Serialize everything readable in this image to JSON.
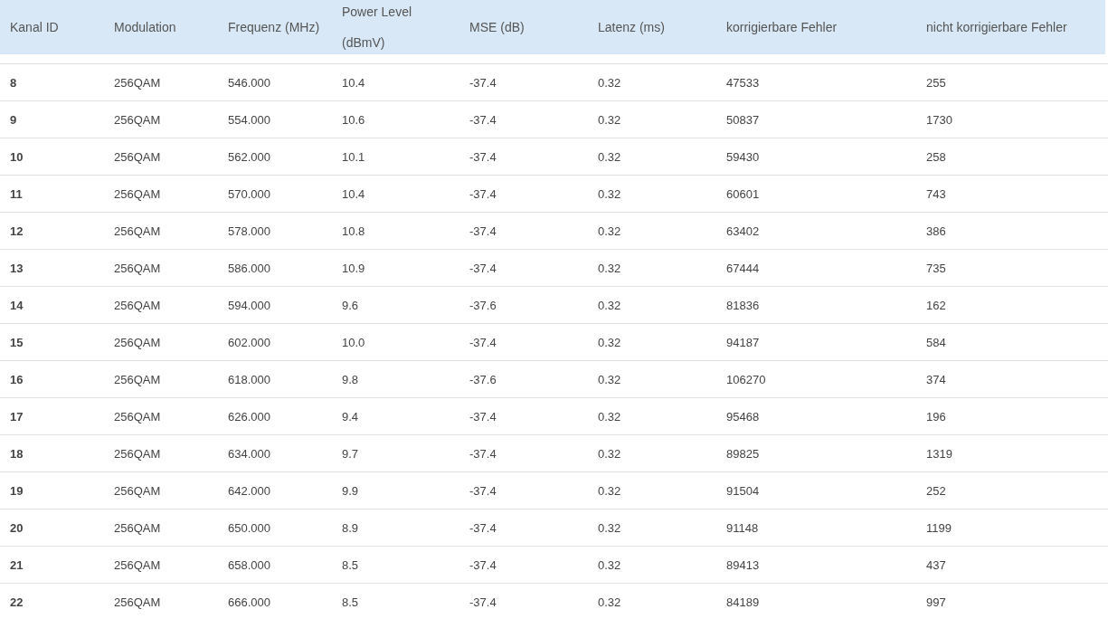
{
  "table": {
    "columns": [
      "Kanal ID",
      "Modulation",
      "Frequenz (MHz)",
      "Power Level (dBmV)",
      "MSE (dB)",
      "Latenz (ms)",
      "korrigierbare Fehler",
      "nicht korrigierbare Fehler"
    ],
    "rows": [
      [
        "8",
        "256QAM",
        "546.000",
        "10.4",
        "-37.4",
        "0.32",
        "47533",
        "255"
      ],
      [
        "9",
        "256QAM",
        "554.000",
        "10.6",
        "-37.4",
        "0.32",
        "50837",
        "1730"
      ],
      [
        "10",
        "256QAM",
        "562.000",
        "10.1",
        "-37.4",
        "0.32",
        "59430",
        "258"
      ],
      [
        "11",
        "256QAM",
        "570.000",
        "10.4",
        "-37.4",
        "0.32",
        "60601",
        "743"
      ],
      [
        "12",
        "256QAM",
        "578.000",
        "10.8",
        "-37.4",
        "0.32",
        "63402",
        "386"
      ],
      [
        "13",
        "256QAM",
        "586.000",
        "10.9",
        "-37.4",
        "0.32",
        "67444",
        "735"
      ],
      [
        "14",
        "256QAM",
        "594.000",
        "9.6",
        "-37.6",
        "0.32",
        "81836",
        "162"
      ],
      [
        "15",
        "256QAM",
        "602.000",
        "10.0",
        "-37.4",
        "0.32",
        "94187",
        "584"
      ],
      [
        "16",
        "256QAM",
        "618.000",
        "9.8",
        "-37.6",
        "0.32",
        "106270",
        "374"
      ],
      [
        "17",
        "256QAM",
        "626.000",
        "9.4",
        "-37.4",
        "0.32",
        "95468",
        "196"
      ],
      [
        "18",
        "256QAM",
        "634.000",
        "9.7",
        "-37.4",
        "0.32",
        "89825",
        "1319"
      ],
      [
        "19",
        "256QAM",
        "642.000",
        "9.9",
        "-37.4",
        "0.32",
        "91504",
        "252"
      ],
      [
        "20",
        "256QAM",
        "650.000",
        "8.9",
        "-37.4",
        "0.32",
        "91148",
        "1199"
      ],
      [
        "21",
        "256QAM",
        "658.000",
        "8.5",
        "-37.4",
        "0.32",
        "89413",
        "437"
      ],
      [
        "22",
        "256QAM",
        "666.000",
        "8.5",
        "-37.4",
        "0.32",
        "84189",
        "997"
      ]
    ]
  }
}
